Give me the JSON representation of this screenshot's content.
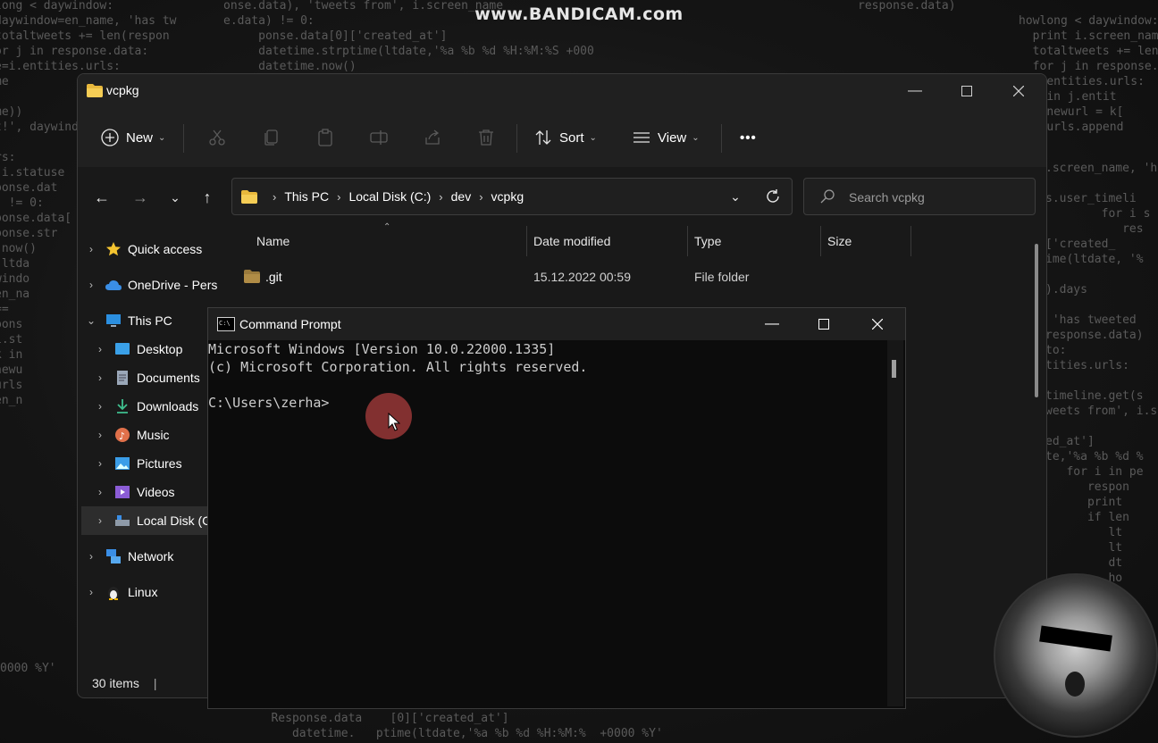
{
  "watermark": "www.BANDICAM.com",
  "explorer": {
    "title": "vcpkg",
    "toolbar": {
      "new_label": "New",
      "sort_label": "Sort",
      "view_label": "View",
      "more_label": "•••"
    },
    "breadcrumbs": [
      "This PC",
      "Local Disk (C:)",
      "dev",
      "vcpkg"
    ],
    "search_placeholder": "Search vcpkg",
    "sidebar": [
      {
        "label": "Quick access",
        "icon": "star-icon"
      },
      {
        "label": "OneDrive - Pers",
        "icon": "cloud-icon"
      },
      {
        "label": "This PC",
        "icon": "pc-icon"
      },
      {
        "label": "Desktop",
        "icon": "desktop-icon"
      },
      {
        "label": "Documents",
        "icon": "documents-icon"
      },
      {
        "label": "Downloads",
        "icon": "download-icon"
      },
      {
        "label": "Music",
        "icon": "music-icon"
      },
      {
        "label": "Pictures",
        "icon": "pictures-icon"
      },
      {
        "label": "Videos",
        "icon": "videos-icon"
      },
      {
        "label": "Local Disk (C",
        "icon": "drive-icon"
      },
      {
        "label": "Network",
        "icon": "network-icon"
      },
      {
        "label": "Linux",
        "icon": "linux-icon"
      }
    ],
    "columns": [
      "Name",
      "Date modified",
      "Type",
      "Size"
    ],
    "files": [
      {
        "name": ".git",
        "date": "15.12.2022 00:59",
        "type": "File folder",
        "size": ""
      }
    ],
    "status": "30 items",
    "status_sep": "|"
  },
  "cmd": {
    "title": "Command Prompt",
    "lines": [
      "Microsoft Windows [Version 10.0.22000.1335]",
      "(c) Microsoft Corporation. All rights reserved.",
      "",
      "C:\\Users\\zerha>"
    ]
  },
  "colors": {
    "window_bg": "#191919",
    "chrome_bg": "#202020",
    "console_bg": "#0c0c0c",
    "console_text": "#cccccc",
    "folder_yellow": "#f0c040",
    "cursor_highlight": "#aa3c3c"
  }
}
